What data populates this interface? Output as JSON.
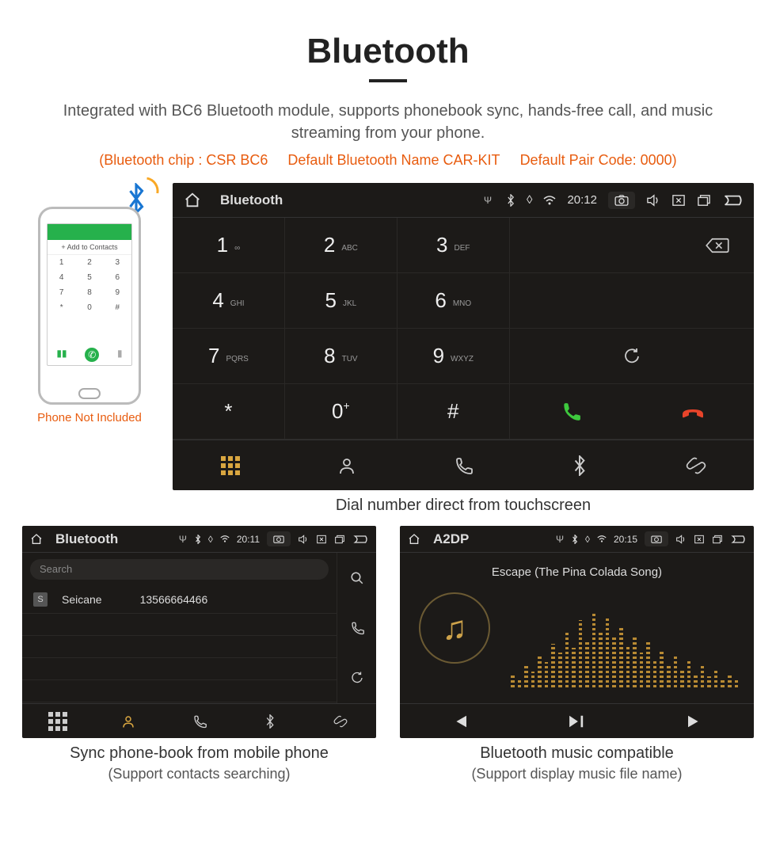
{
  "header": {
    "title": "Bluetooth",
    "desc": "Integrated with BC6 Bluetooth module, supports phonebook sync, hands-free call, and music streaming from your phone.",
    "specs": [
      "(Bluetooth chip : CSR BC6",
      "Default Bluetooth Name CAR-KIT",
      "Default Pair Code: 0000)"
    ]
  },
  "phone": {
    "add_contacts": "+ Add to Contacts",
    "note": "Phone Not Included"
  },
  "dialer": {
    "status": {
      "title": "Bluetooth",
      "time": "20:12"
    },
    "keys": [
      {
        "n": "1",
        "l": "∞"
      },
      {
        "n": "2",
        "l": "ABC"
      },
      {
        "n": "3",
        "l": "DEF"
      },
      {
        "n": "4",
        "l": "GHI"
      },
      {
        "n": "5",
        "l": "JKL"
      },
      {
        "n": "6",
        "l": "MNO"
      },
      {
        "n": "7",
        "l": "PQRS"
      },
      {
        "n": "8",
        "l": "TUV"
      },
      {
        "n": "9",
        "l": "WXYZ"
      },
      {
        "n": "*",
        "l": ""
      },
      {
        "n": "0",
        "l": "+"
      },
      {
        "n": "#",
        "l": ""
      }
    ],
    "caption": "Dial number direct from touchscreen"
  },
  "phonebook": {
    "status": {
      "title": "Bluetooth",
      "time": "20:11"
    },
    "search_placeholder": "Search",
    "contacts": [
      {
        "badge": "S",
        "name": "Seicane",
        "number": "13566664466"
      }
    ],
    "caption": "Sync phone-book from mobile phone",
    "subcaption": "(Support contacts searching)"
  },
  "a2dp": {
    "status": {
      "title": "A2DP",
      "time": "20:15"
    },
    "track": "Escape (The Pina Colada Song)",
    "caption": "Bluetooth music compatible",
    "subcaption": "(Support display music file name)"
  },
  "eq_heights": [
    18,
    12,
    28,
    20,
    40,
    32,
    55,
    44,
    70,
    50,
    85,
    60,
    95,
    72,
    88,
    64,
    76,
    52,
    66,
    44,
    58,
    36,
    48,
    28,
    40,
    22,
    34,
    18,
    28,
    14,
    22,
    12,
    18,
    10
  ]
}
